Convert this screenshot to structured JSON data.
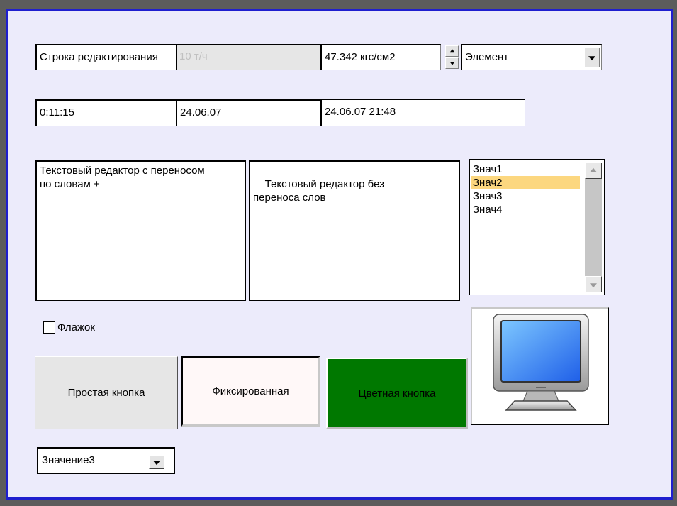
{
  "row1": {
    "edit_string": "Строка редактирования",
    "disabled_value": "10 т/ч",
    "pressure_value": "47.342 кгс/см2",
    "element_select": "Элемент"
  },
  "row2": {
    "time_value": "0:11:15",
    "date_value": "24.06.07",
    "datetime_value": "24.06.07 21:48"
  },
  "text_editors": {
    "wrap_text": "Текстовый редактор с переносом по словам +",
    "nowrap_text": "Текстовый редактор без\nпереноса слов"
  },
  "listbox": {
    "items": [
      "Знач1",
      "Знач2",
      "Знач3",
      "Знач4"
    ],
    "selected_index": 1
  },
  "checkbox": {
    "label": "Флажок",
    "checked": false
  },
  "buttons": {
    "simple": "Простая кнопка",
    "fixed": "Фиксированная",
    "colored": "Цветная кнопка"
  },
  "bottom_select": {
    "value": "Значение3"
  },
  "colors": {
    "panel_bg": "#ecebfb",
    "panel_border": "#1f1fcf",
    "list_selection": "#fcd77f",
    "colored_button": "#007800"
  },
  "icons": {
    "monitor": "monitor-icon"
  }
}
